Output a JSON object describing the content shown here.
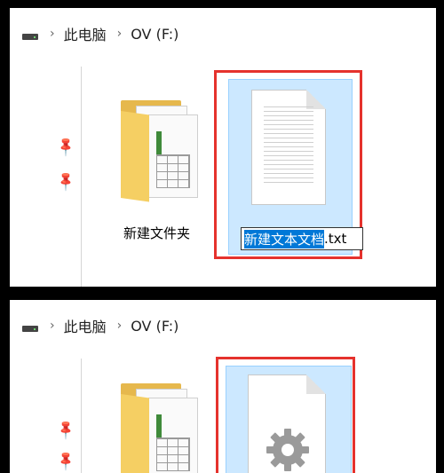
{
  "top": {
    "breadcrumb": {
      "this_pc": "此电脑",
      "drive": "OV (F:)"
    },
    "folder_label": "新建文件夹",
    "rename": {
      "selected": "新建文本文档",
      "ext": ".txt"
    }
  },
  "bottom": {
    "breadcrumb": {
      "this_pc": "此电脑",
      "drive": "OV (F:)"
    }
  },
  "icons": {
    "drive": "drive-icon",
    "chevron": "chevron-right-icon",
    "pin": "pin-icon",
    "folder": "folder-icon",
    "text_file": "text-file-icon",
    "settings_file": "gear-file-icon"
  },
  "colors": {
    "selection": "#cce8ff",
    "highlight": "#e5322d",
    "rename_highlight": "#0078d7"
  }
}
